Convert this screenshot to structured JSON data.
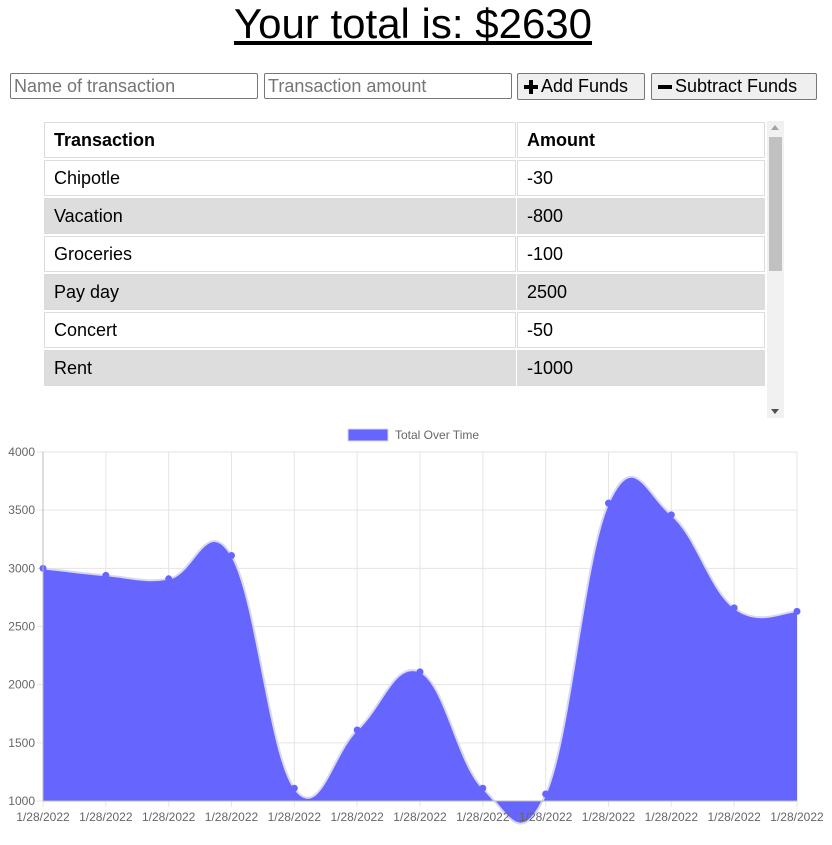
{
  "header": {
    "total_text": "Your total is: $2630"
  },
  "form": {
    "name_placeholder": "Name of transaction",
    "amount_placeholder": "Transaction amount",
    "add_label": "Add Funds",
    "subtract_label": "Subtract Funds"
  },
  "table": {
    "headers": [
      "Transaction",
      "Amount"
    ],
    "rows": [
      {
        "name": "Chipotle",
        "amount": "-30"
      },
      {
        "name": "Vacation",
        "amount": "-800"
      },
      {
        "name": "Groceries",
        "amount": "-100"
      },
      {
        "name": "Pay day",
        "amount": "2500"
      },
      {
        "name": "Concert",
        "amount": "-50"
      },
      {
        "name": "Rent",
        "amount": "-1000"
      }
    ]
  },
  "colors": {
    "fill": "#6666ff",
    "stroke": "#d8d8ee",
    "grid": "#e5e5e5"
  },
  "chart_data": {
    "type": "area",
    "legend": "Total Over Time",
    "legend_position": "top",
    "grid": true,
    "x": [
      "1/28/2022",
      "1/28/2022",
      "1/28/2022",
      "1/28/2022",
      "1/28/2022",
      "1/28/2022",
      "1/28/2022",
      "1/28/2022",
      "1/28/2022",
      "1/28/2022",
      "1/28/2022",
      "1/28/2022",
      "1/28/2022"
    ],
    "values": [
      3000,
      2940,
      2910,
      3110,
      1110,
      1610,
      2110,
      1110,
      1060,
      3560,
      3460,
      2660,
      2630
    ],
    "y_ticks": [
      1000,
      1500,
      2000,
      2500,
      3000,
      3500,
      4000
    ],
    "ylim": [
      1000,
      4000
    ]
  }
}
